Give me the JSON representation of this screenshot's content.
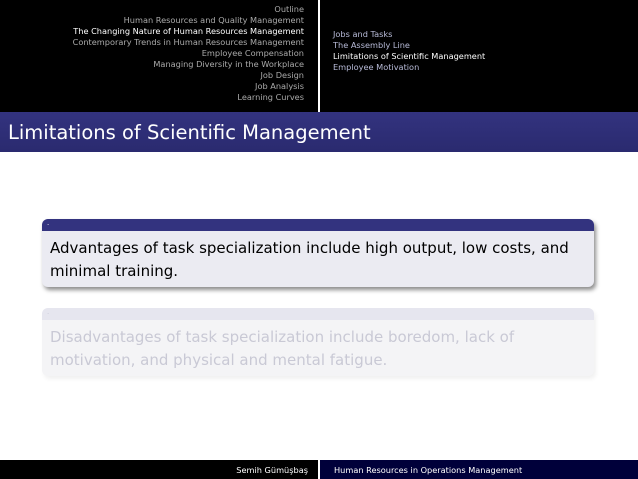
{
  "nav": {
    "sections": [
      {
        "label": "Outline",
        "active": false
      },
      {
        "label": "Human Resources and Quality Management",
        "active": false
      },
      {
        "label": "The Changing Nature of Human Resources Management",
        "active": true
      },
      {
        "label": "Contemporary Trends in Human Resources Management",
        "active": false
      },
      {
        "label": "Employee Compensation",
        "active": false
      },
      {
        "label": "Managing Diversity in the Workplace",
        "active": false
      },
      {
        "label": "Job Design",
        "active": false
      },
      {
        "label": "Job Analysis",
        "active": false
      },
      {
        "label": "Learning Curves",
        "active": false
      }
    ],
    "subsections": [
      {
        "label": "Jobs and Tasks",
        "active": false
      },
      {
        "label": "The Assembly Line",
        "active": false
      },
      {
        "label": "Limitations of Scientific Management",
        "active": true
      },
      {
        "label": "Employee Motivation",
        "active": false
      }
    ]
  },
  "slide": {
    "title": "Limitations of Scientific Management",
    "blocks": [
      {
        "header": "·",
        "text": "Advantages of task specialization include high output, low costs, and minimal training."
      },
      {
        "header": "·",
        "text": "Disadvantages of task specialization include boredom, lack of motivation, and physical and mental fatigue."
      }
    ]
  },
  "footer": {
    "author": "Semih Gümüşbaş",
    "short_title": "Human Resources in Operations Management"
  },
  "colors": {
    "structure": "#33337f",
    "header_bg": "#000000",
    "footer_right_bg": "#00003a"
  }
}
